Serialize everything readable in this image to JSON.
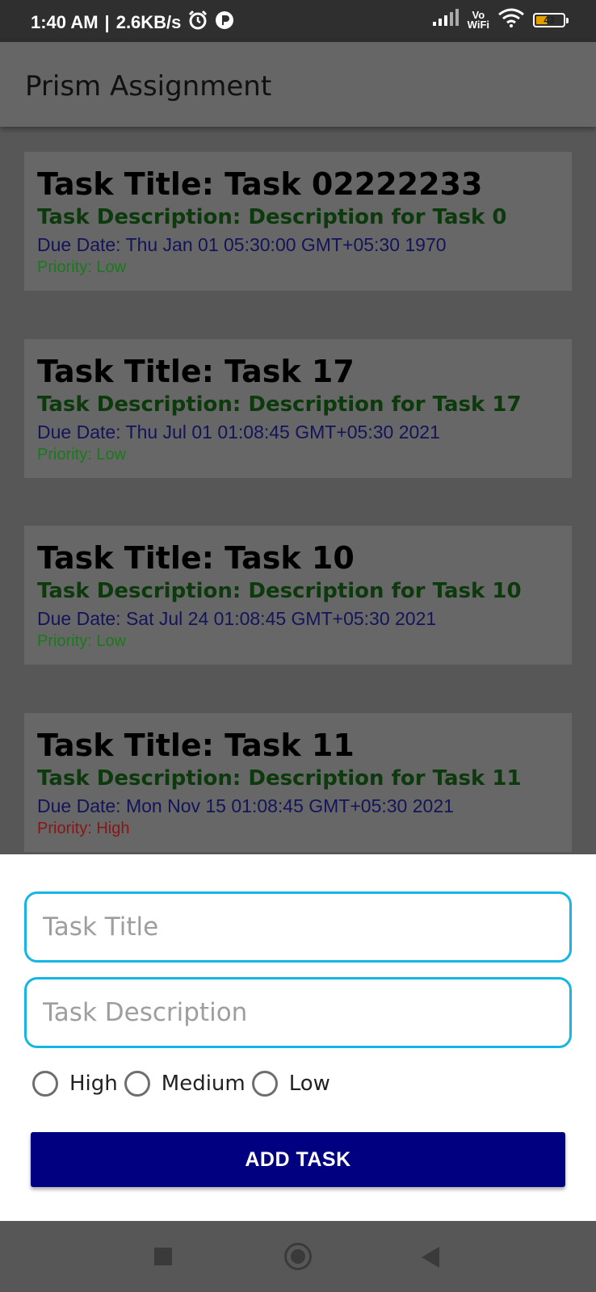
{
  "status_bar": {
    "time": "1:40 AM",
    "speed": "2.6KB/s",
    "vowifi_top": "Vo",
    "vowifi_bottom": "WiFi",
    "battery": "43"
  },
  "app_bar": {
    "title": "Prism Assignment"
  },
  "tasks": [
    {
      "title": "Task Title: Task 02222233",
      "description": "Task Description: Description for Task 0",
      "due": "Due Date: Thu Jan 01 05:30:00 GMT+05:30 1970",
      "priority": "Priority: Low"
    },
    {
      "title": "Task Title: Task 17",
      "description": "Task Description: Description for Task 17",
      "due": "Due Date: Thu Jul 01 01:08:45 GMT+05:30 2021",
      "priority": "Priority: Low"
    },
    {
      "title": "Task Title: Task 10",
      "description": "Task Description: Description for Task 10",
      "due": "Due Date: Sat Jul 24 01:08:45 GMT+05:30 2021",
      "priority": "Priority: Low"
    },
    {
      "title": "Task Title: Task 11",
      "description": "Task Description: Description for Task 11",
      "due": "Due Date: Mon Nov 15 01:08:45 GMT+05:30 2021",
      "priority": "Priority: High"
    }
  ],
  "colors": {
    "priority_low": "#1a7a1a",
    "priority_high": "#8b1515",
    "field_border": "#15b5e6",
    "button_bg": "#000080"
  },
  "form": {
    "title_placeholder": "Task Title",
    "title_value": "",
    "description_placeholder": "Task Description",
    "description_value": "",
    "priority_options": [
      "High",
      "Medium",
      "Low"
    ],
    "add_button_label": "ADD TASK"
  },
  "icons": {
    "alarm": "alarm-clock-icon",
    "app_notification": "notification-icon",
    "signal": "signal-icon",
    "wifi": "wifi-icon",
    "battery": "battery-icon",
    "nav_recents": "recents-square-icon",
    "nav_home": "home-circle-icon",
    "nav_back": "back-triangle-icon"
  }
}
